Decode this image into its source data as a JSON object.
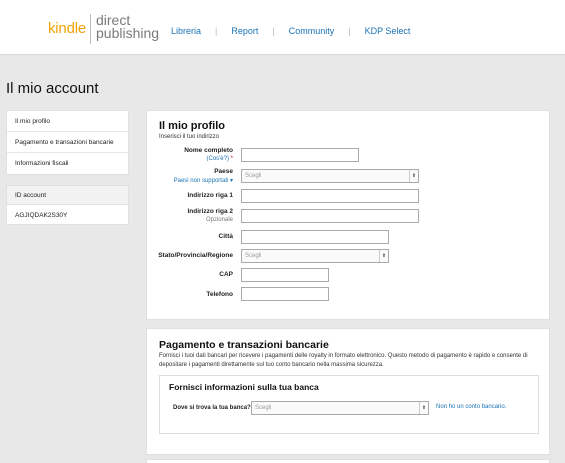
{
  "brand": {
    "kindle": "kindle",
    "line1": "direct",
    "line2": "publishing"
  },
  "nav": {
    "items": [
      "Libreria",
      "Report",
      "Community",
      "KDP Select"
    ]
  },
  "page": {
    "title": "Il mio account"
  },
  "sidebar": {
    "items": [
      "Il mio profilo",
      "Pagamento e transazioni bancarie",
      "Informazioni fiscali"
    ],
    "account_label": "ID account",
    "account_value": "AGJIQDAK2S30Y"
  },
  "profile": {
    "title": "Il mio profilo",
    "subtitle": "Inserisci il tuo indirizzo",
    "fields": {
      "name_label": "Nome completo",
      "name_help": "(Cos'è?)",
      "country_label": "Paese",
      "country_help": "Paesi non supportati",
      "country_value": "Scegli",
      "addr1_label": "Indirizzo riga 1",
      "addr2_label": "Indirizzo riga 2",
      "addr2_optional": "Opzionale",
      "city_label": "Città",
      "state_label": "Stato/Provincia/Regione",
      "state_value": "Scegli",
      "zip_label": "CAP",
      "phone_label": "Telefono"
    }
  },
  "payment": {
    "title": "Pagamento e transazioni bancarie",
    "description": "Fornisci i tuoi dati bancari per ricevere i pagamenti delle royalty in formato elettronico. Questo metodo di pagamento è rapido e consente di depositare i pagamenti direttamente sul tuo conto bancario nella massima sicurezza.",
    "bank_box_title": "Fornisci informazioni sulla tua banca",
    "bank_location_label": "Dove si trova la tua banca?",
    "bank_location_value": "Scegli",
    "no_account_link": "Non ho un conto bancario."
  },
  "colors": {
    "accent_link": "#1a73b6",
    "brand_orange": "#f0a30a"
  },
  "icons": {
    "select_arrow": "chevron-updown-icon"
  }
}
